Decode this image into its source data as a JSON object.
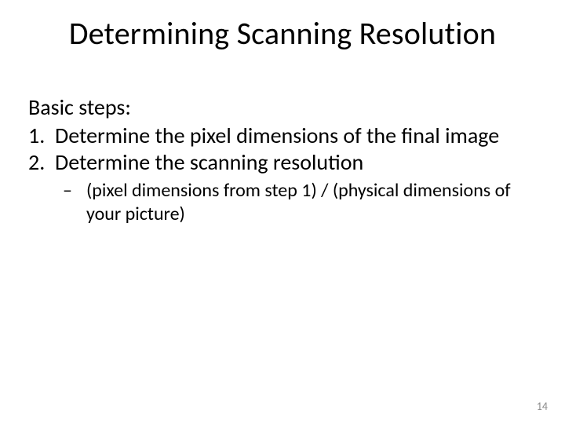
{
  "slide": {
    "title": "Determining Scanning Resolution",
    "intro": "Basic steps:",
    "items": [
      {
        "num": "1.",
        "text": "Determine the pixel dimensions of the final image"
      },
      {
        "num": "2.",
        "text": "Determine the scanning resolution"
      }
    ],
    "sub": {
      "dash": "–",
      "text": "(pixel dimensions from step 1) / (physical dimensions of your picture)"
    },
    "page_number": "14"
  }
}
